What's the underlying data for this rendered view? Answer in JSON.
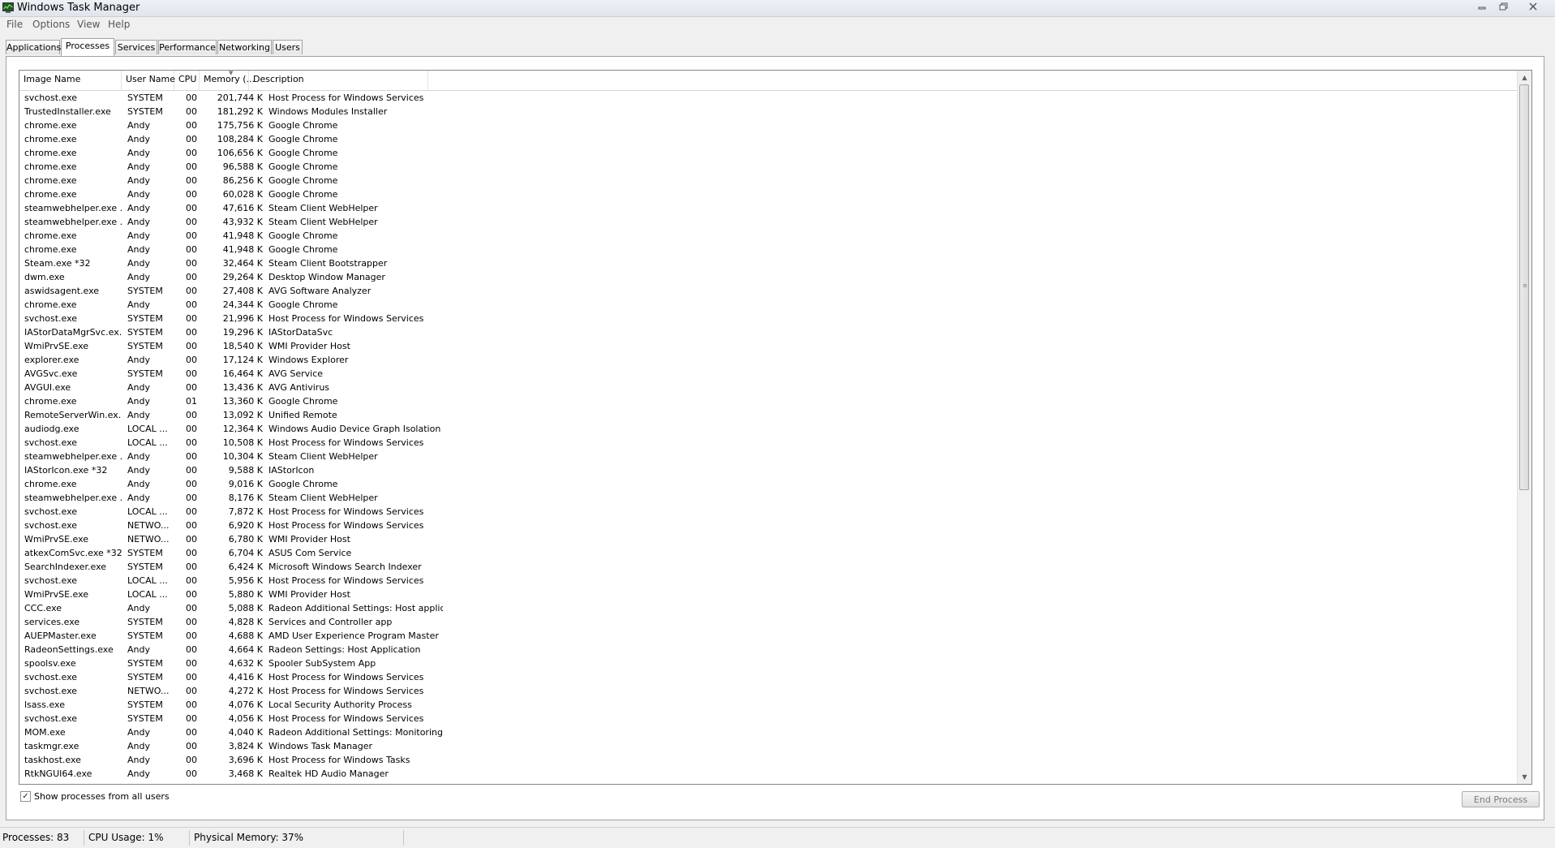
{
  "window": {
    "title": "Windows Task Manager"
  },
  "menu": [
    "File",
    "Options",
    "View",
    "Help"
  ],
  "tabs": [
    "Applications",
    "Processes",
    "Services",
    "Performance",
    "Networking",
    "Users"
  ],
  "active_tab": "Processes",
  "columns": [
    "Image Name",
    "User Name",
    "CPU",
    "Memory (...",
    "Description"
  ],
  "processes": [
    [
      "svchost.exe",
      "SYSTEM",
      "00",
      "201,744 K",
      "Host Process for Windows Services"
    ],
    [
      "TrustedInstaller.exe",
      "SYSTEM",
      "00",
      "181,292 K",
      "Windows Modules Installer"
    ],
    [
      "chrome.exe",
      "Andy",
      "00",
      "175,756 K",
      "Google Chrome"
    ],
    [
      "chrome.exe",
      "Andy",
      "00",
      "108,284 K",
      "Google Chrome"
    ],
    [
      "chrome.exe",
      "Andy",
      "00",
      "106,656 K",
      "Google Chrome"
    ],
    [
      "chrome.exe",
      "Andy",
      "00",
      "96,588 K",
      "Google Chrome"
    ],
    [
      "chrome.exe",
      "Andy",
      "00",
      "86,256 K",
      "Google Chrome"
    ],
    [
      "chrome.exe",
      "Andy",
      "00",
      "60,028 K",
      "Google Chrome"
    ],
    [
      "steamwebhelper.exe ...",
      "Andy",
      "00",
      "47,616 K",
      "Steam Client WebHelper"
    ],
    [
      "steamwebhelper.exe ...",
      "Andy",
      "00",
      "43,932 K",
      "Steam Client WebHelper"
    ],
    [
      "chrome.exe",
      "Andy",
      "00",
      "41,948 K",
      "Google Chrome"
    ],
    [
      "chrome.exe",
      "Andy",
      "00",
      "41,948 K",
      "Google Chrome"
    ],
    [
      "Steam.exe *32",
      "Andy",
      "00",
      "32,464 K",
      "Steam Client Bootstrapper"
    ],
    [
      "dwm.exe",
      "Andy",
      "00",
      "29,264 K",
      "Desktop Window Manager"
    ],
    [
      "aswidsagent.exe",
      "SYSTEM",
      "00",
      "27,408 K",
      "AVG Software Analyzer"
    ],
    [
      "chrome.exe",
      "Andy",
      "00",
      "24,344 K",
      "Google Chrome"
    ],
    [
      "svchost.exe",
      "SYSTEM",
      "00",
      "21,996 K",
      "Host Process for Windows Services"
    ],
    [
      "IAStorDataMgrSvc.ex...",
      "SYSTEM",
      "00",
      "19,296 K",
      "IAStorDataSvc"
    ],
    [
      "WmiPrvSE.exe",
      "SYSTEM",
      "00",
      "18,540 K",
      "WMI Provider Host"
    ],
    [
      "explorer.exe",
      "Andy",
      "00",
      "17,124 K",
      "Windows Explorer"
    ],
    [
      "AVGSvc.exe",
      "SYSTEM",
      "00",
      "16,464 K",
      "AVG Service"
    ],
    [
      "AVGUI.exe",
      "Andy",
      "00",
      "13,436 K",
      "AVG Antivirus"
    ],
    [
      "chrome.exe",
      "Andy",
      "01",
      "13,360 K",
      "Google Chrome"
    ],
    [
      "RemoteServerWin.ex...",
      "Andy",
      "00",
      "13,092 K",
      "Unified Remote"
    ],
    [
      "audiodg.exe",
      "LOCAL ...",
      "00",
      "12,364 K",
      "Windows Audio Device Graph Isolation"
    ],
    [
      "svchost.exe",
      "LOCAL ...",
      "00",
      "10,508 K",
      "Host Process for Windows Services"
    ],
    [
      "steamwebhelper.exe ...",
      "Andy",
      "00",
      "10,304 K",
      "Steam Client WebHelper"
    ],
    [
      "IAStorIcon.exe *32",
      "Andy",
      "00",
      "9,588 K",
      "IAStorIcon"
    ],
    [
      "chrome.exe",
      "Andy",
      "00",
      "9,016 K",
      "Google Chrome"
    ],
    [
      "steamwebhelper.exe ...",
      "Andy",
      "00",
      "8,176 K",
      "Steam Client WebHelper"
    ],
    [
      "svchost.exe",
      "LOCAL ...",
      "00",
      "7,872 K",
      "Host Process for Windows Services"
    ],
    [
      "svchost.exe",
      "NETWO...",
      "00",
      "6,920 K",
      "Host Process for Windows Services"
    ],
    [
      "WmiPrvSE.exe",
      "NETWO...",
      "00",
      "6,780 K",
      "WMI Provider Host"
    ],
    [
      "atkexComSvc.exe *32",
      "SYSTEM",
      "00",
      "6,704 K",
      "ASUS Com Service"
    ],
    [
      "SearchIndexer.exe",
      "SYSTEM",
      "00",
      "6,424 K",
      "Microsoft Windows Search Indexer"
    ],
    [
      "svchost.exe",
      "LOCAL ...",
      "00",
      "5,956 K",
      "Host Process for Windows Services"
    ],
    [
      "WmiPrvSE.exe",
      "LOCAL ...",
      "00",
      "5,880 K",
      "WMI Provider Host"
    ],
    [
      "CCC.exe",
      "Andy",
      "00",
      "5,088 K",
      "Radeon Additional Settings: Host applica..."
    ],
    [
      "services.exe",
      "SYSTEM",
      "00",
      "4,828 K",
      "Services and Controller app"
    ],
    [
      "AUEPMaster.exe",
      "SYSTEM",
      "00",
      "4,688 K",
      "AMD User Experience Program Master"
    ],
    [
      "RadeonSettings.exe",
      "Andy",
      "00",
      "4,664 K",
      "Radeon Settings: Host Application"
    ],
    [
      "spoolsv.exe",
      "SYSTEM",
      "00",
      "4,632 K",
      "Spooler SubSystem App"
    ],
    [
      "svchost.exe",
      "SYSTEM",
      "00",
      "4,416 K",
      "Host Process for Windows Services"
    ],
    [
      "svchost.exe",
      "NETWO...",
      "00",
      "4,272 K",
      "Host Process for Windows Services"
    ],
    [
      "lsass.exe",
      "SYSTEM",
      "00",
      "4,076 K",
      "Local Security Authority Process"
    ],
    [
      "svchost.exe",
      "SYSTEM",
      "00",
      "4,056 K",
      "Host Process for Windows Services"
    ],
    [
      "MOM.exe",
      "Andy",
      "00",
      "4,040 K",
      "Radeon Additional Settings: Monitoring p..."
    ],
    [
      "taskmgr.exe",
      "Andy",
      "00",
      "3,824 K",
      "Windows Task Manager"
    ],
    [
      "taskhost.exe",
      "Andy",
      "00",
      "3,696 K",
      "Host Process for Windows Tasks"
    ],
    [
      "RtkNGUI64.exe",
      "Andy",
      "00",
      "3,468 K",
      "Realtek HD Audio Manager"
    ]
  ],
  "show_all_label": "Show processes from all users",
  "show_all_checked": true,
  "end_process_label": "End Process",
  "status": {
    "processes": "Processes: 83",
    "cpu": "CPU Usage: 1%",
    "memory": "Physical Memory: 37%"
  }
}
